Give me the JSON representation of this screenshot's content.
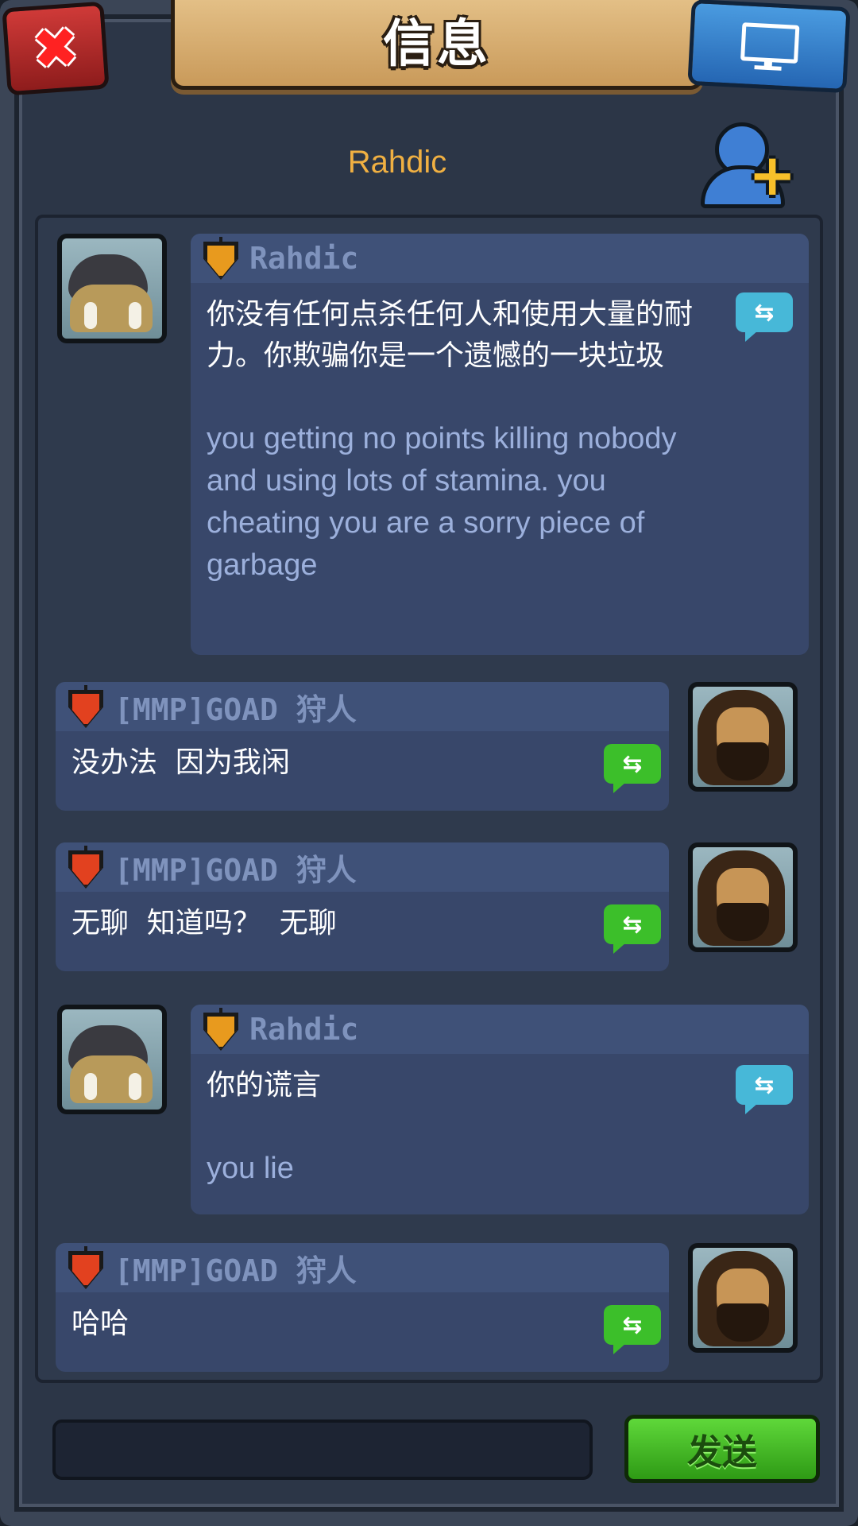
{
  "header": {
    "title": "信息",
    "close_icon": "close-icon",
    "screen_icon": "monitor-icon"
  },
  "contact": {
    "name": "Rahdic",
    "add_friend_icon": "add-friend-icon"
  },
  "messages": [
    {
      "side": "left",
      "sender": "Rahdic",
      "badge_color": "#e89a1e",
      "avatar": "armadillo-avatar",
      "text_zh": "你没有任何点杀任何人和使用大量的耐力。你欺骗你是一个遗憾的一块垃圾",
      "text_en": "you getting no points killing nobody and using lots of stamina. you cheating you are a sorry piece of garbage"
    },
    {
      "side": "right",
      "sender": "[MMP]GOAD 狩人",
      "badge_color": "#e2411f",
      "avatar": "hunter-avatar",
      "text_zh": "没办法  因为我闲"
    },
    {
      "side": "right",
      "sender": "[MMP]GOAD 狩人",
      "badge_color": "#e2411f",
      "avatar": "hunter-avatar",
      "text_zh": "无聊  知道吗？  无聊"
    },
    {
      "side": "left",
      "sender": "Rahdic",
      "badge_color": "#e89a1e",
      "avatar": "armadillo-avatar",
      "text_zh": "你的谎言",
      "text_en": "you lie"
    },
    {
      "side": "right",
      "sender": "[MMP]GOAD 狩人",
      "badge_color": "#e2411f",
      "avatar": "hunter-avatar",
      "text_zh": "哈哈"
    }
  ],
  "composer": {
    "input_value": "",
    "send_label": "发送"
  },
  "colors": {
    "send_green": "#3cbf2a",
    "name_orange": "#f0b042",
    "translate_blue": "#47b8d8"
  }
}
